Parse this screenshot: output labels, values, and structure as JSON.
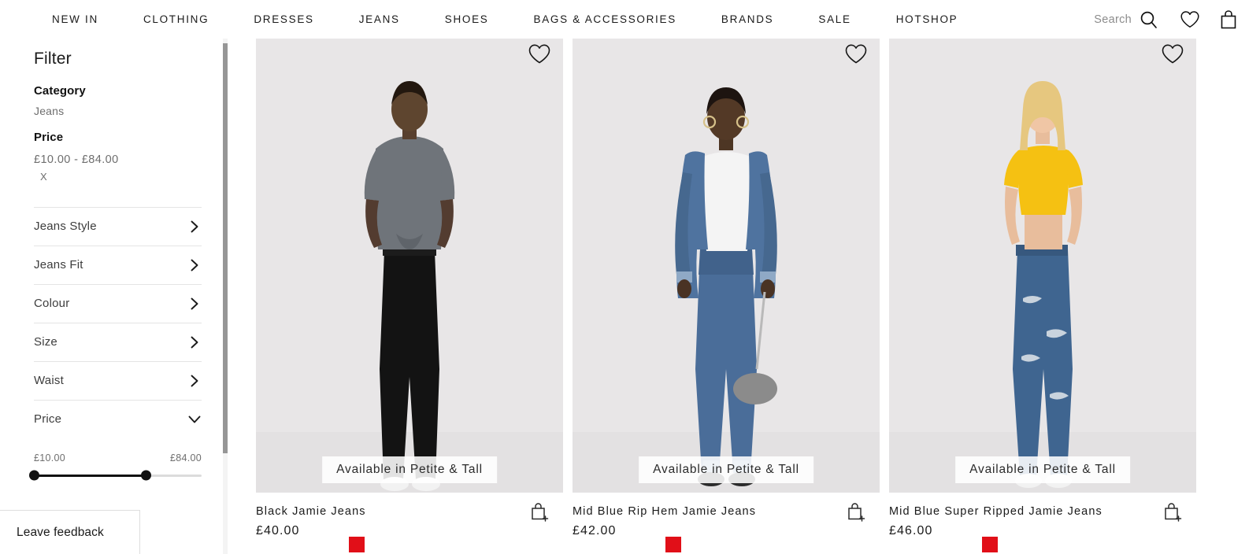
{
  "header": {
    "nav_items": [
      {
        "label": "NEW IN",
        "name": "nav-new-in"
      },
      {
        "label": "CLOTHING",
        "name": "nav-clothing"
      },
      {
        "label": "DRESSES",
        "name": "nav-dresses"
      },
      {
        "label": "JEANS",
        "name": "nav-jeans"
      },
      {
        "label": "SHOES",
        "name": "nav-shoes"
      },
      {
        "label": "BAGS & ACCESSORIES",
        "name": "nav-bags-accessories"
      },
      {
        "label": "BRANDS",
        "name": "nav-brands"
      },
      {
        "label": "SALE",
        "name": "nav-sale"
      },
      {
        "label": "HOTSHOP",
        "name": "nav-hotshop"
      }
    ],
    "search_label": "Search",
    "icons": {
      "search": "search-icon",
      "wishlist": "heart-icon",
      "bag": "shopping-bag-icon"
    }
  },
  "sidebar": {
    "title": "Filter",
    "applied": [
      {
        "heading": "Category",
        "value": "Jeans"
      },
      {
        "heading": "Price",
        "value": "£10.00 - £84.00",
        "remove": "X"
      }
    ],
    "accordion": [
      {
        "label": "Jeans Style",
        "state": "collapsed",
        "icon": "chevron-right-icon"
      },
      {
        "label": "Jeans Fit",
        "state": "collapsed",
        "icon": "chevron-right-icon"
      },
      {
        "label": "Colour",
        "state": "collapsed",
        "icon": "chevron-right-icon"
      },
      {
        "label": "Size",
        "state": "collapsed",
        "icon": "chevron-right-icon"
      },
      {
        "label": "Waist",
        "state": "collapsed",
        "icon": "chevron-right-icon"
      },
      {
        "label": "Price",
        "state": "expanded",
        "icon": "chevron-down-icon"
      }
    ],
    "price_slider": {
      "min_label": "£10.00",
      "max_label": "£84.00",
      "left_percent": 0,
      "right_percent": 67
    },
    "scrollbar": {
      "thumb_color": "#969696"
    }
  },
  "feedback": {
    "label": "Leave feedback",
    "icon": "chevron-right-icon"
  },
  "products": [
    {
      "title": "Black Jamie Jeans",
      "price": "£40.00",
      "badge": "Available in Petite & Tall",
      "wishlist_icon": "heart-icon",
      "add_to_bag_icon": "bag-add-icon",
      "swatches": [
        "#e10f18"
      ]
    },
    {
      "title": "Mid Blue Rip Hem Jamie Jeans",
      "price": "£42.00",
      "badge": "Available in Petite & Tall",
      "wishlist_icon": "heart-icon",
      "add_to_bag_icon": "bag-add-icon",
      "swatches": [
        "#e10f18"
      ]
    },
    {
      "title": "Mid Blue Super Ripped Jamie Jeans",
      "price": "£46.00",
      "badge": "Available in Petite & Tall",
      "wishlist_icon": "heart-icon",
      "add_to_bag_icon": "bag-add-icon",
      "swatches": [
        "#e10f18"
      ]
    }
  ],
  "colors": {
    "page_background": "#ffffff",
    "product_tile_background": "#e8e6e7",
    "text_primary": "#1a1a1a",
    "text_muted": "#6e6e6e",
    "divider": "#e4e4e4",
    "slider_active": "#111111",
    "swatch_red": "#e10f18"
  }
}
